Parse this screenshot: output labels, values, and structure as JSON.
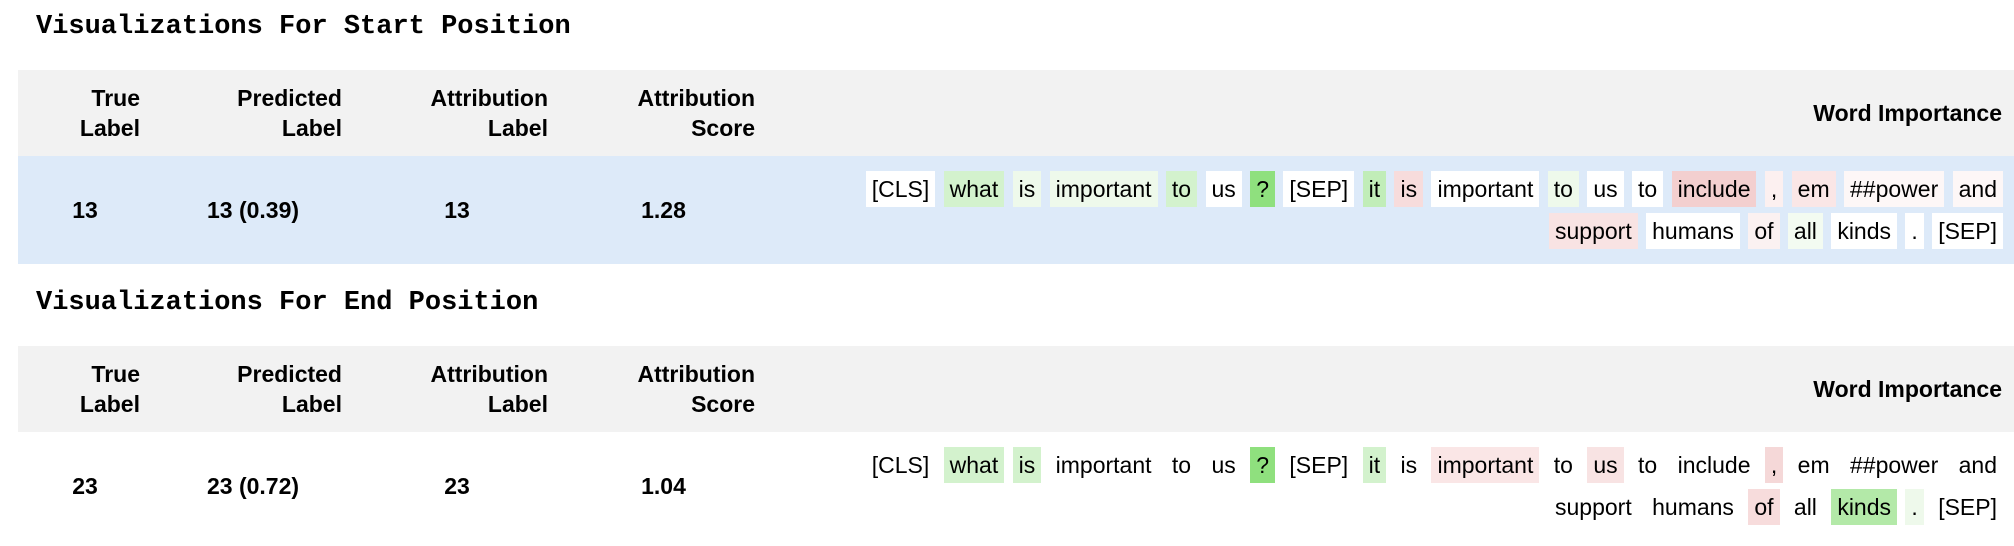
{
  "sections": [
    {
      "title": "Visualizations For Start Position",
      "headers": {
        "true_label": [
          "True",
          "Label"
        ],
        "predicted_label": [
          "Predicted",
          "Label"
        ],
        "attribution_label": [
          "Attribution",
          "Label"
        ],
        "attribution_score": [
          "Attribution",
          "Score"
        ],
        "word_importance": "Word Importance"
      },
      "row": {
        "true_label": "13",
        "predicted_label": "13 (0.39)",
        "attribution_label": "13",
        "attribution_score": "1.28"
      },
      "tokens": [
        {
          "text": "[CLS]",
          "color": "#ffffff"
        },
        {
          "text": "what",
          "color": "#d3f2cd"
        },
        {
          "text": "is",
          "color": "#eef9eb"
        },
        {
          "text": "important",
          "color": "#eef9eb"
        },
        {
          "text": "to",
          "color": "#d3f2cd"
        },
        {
          "text": "us",
          "color": "#ffffff"
        },
        {
          "text": "?",
          "color": "#8fe07e"
        },
        {
          "text": "[SEP]",
          "color": "#ffffff"
        },
        {
          "text": "it",
          "color": "#c1edb8"
        },
        {
          "text": "is",
          "color": "#f7dcdc"
        },
        {
          "text": "important",
          "color": "#ffffff"
        },
        {
          "text": "to",
          "color": "#eef9eb"
        },
        {
          "text": "us",
          "color": "#ffffff"
        },
        {
          "text": "to",
          "color": "#ffffff"
        },
        {
          "text": "include",
          "color": "#f3cfcf"
        },
        {
          "text": ",",
          "color": "#fcf0f0"
        },
        {
          "text": "em",
          "color": "#fae6e6"
        },
        {
          "text": "##power",
          "color": "#fdf7f7"
        },
        {
          "text": "and",
          "color": "#fdf7f7"
        },
        {
          "text": "support",
          "color": "#f8e3e3"
        },
        {
          "text": "humans",
          "color": "#ffffff"
        },
        {
          "text": "of",
          "color": "#fbf1f1"
        },
        {
          "text": "all",
          "color": "#f3fbf1"
        },
        {
          "text": "kinds",
          "color": "#ffffff"
        },
        {
          "text": ".",
          "color": "#ffffff"
        },
        {
          "text": "[SEP]",
          "color": "#ffffff"
        }
      ],
      "row_color": "#ddeaf9"
    },
    {
      "title": "Visualizations For End Position",
      "headers": {
        "true_label": [
          "True",
          "Label"
        ],
        "predicted_label": [
          "Predicted",
          "Label"
        ],
        "attribution_label": [
          "Attribution",
          "Label"
        ],
        "attribution_score": [
          "Attribution",
          "Score"
        ],
        "word_importance": "Word Importance"
      },
      "row": {
        "true_label": "23",
        "predicted_label": "23 (0.72)",
        "attribution_label": "23",
        "attribution_score": "1.04"
      },
      "tokens": [
        {
          "text": "[CLS]",
          "color": "#ffffff"
        },
        {
          "text": "what",
          "color": "#d3f2cd"
        },
        {
          "text": "is",
          "color": "#d3f2cd"
        },
        {
          "text": "important",
          "color": "#ffffff"
        },
        {
          "text": "to",
          "color": "#ffffff"
        },
        {
          "text": "us",
          "color": "#ffffff"
        },
        {
          "text": "?",
          "color": "#8fe07e"
        },
        {
          "text": "[SEP]",
          "color": "#ffffff"
        },
        {
          "text": "it",
          "color": "#d3f2cd"
        },
        {
          "text": "is",
          "color": "#ffffff"
        },
        {
          "text": "important",
          "color": "#fae6e6"
        },
        {
          "text": "to",
          "color": "#ffffff"
        },
        {
          "text": "us",
          "color": "#f8e3e3"
        },
        {
          "text": "to",
          "color": "#ffffff"
        },
        {
          "text": "include",
          "color": "#ffffff"
        },
        {
          "text": ",",
          "color": "#f5d8d8"
        },
        {
          "text": "em",
          "color": "#ffffff"
        },
        {
          "text": "##power",
          "color": "#ffffff"
        },
        {
          "text": "and",
          "color": "#ffffff"
        },
        {
          "text": "support",
          "color": "#ffffff"
        },
        {
          "text": "humans",
          "color": "#ffffff"
        },
        {
          "text": "of",
          "color": "#f7dcdc"
        },
        {
          "text": "all",
          "color": "#ffffff"
        },
        {
          "text": "kinds",
          "color": "#b3e9a8"
        },
        {
          "text": ".",
          "color": "#eef9eb"
        },
        {
          "text": "[SEP]",
          "color": "#ffffff"
        }
      ],
      "row_color": "#ffffff"
    }
  ]
}
